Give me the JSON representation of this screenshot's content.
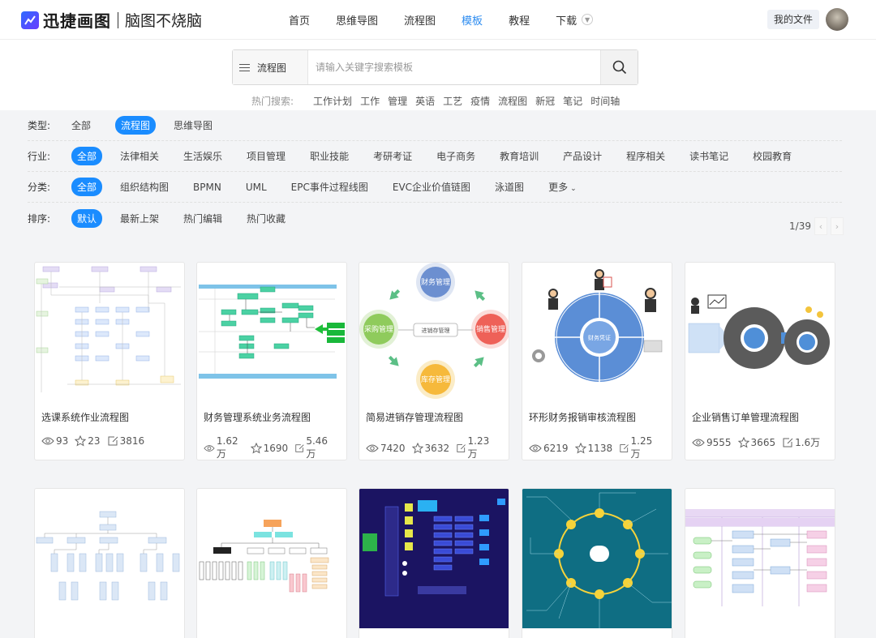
{
  "header": {
    "brand": "迅捷画图",
    "slogan": "脑图不烧脑",
    "nav": [
      {
        "label": "首页",
        "active": false
      },
      {
        "label": "思维导图",
        "active": false
      },
      {
        "label": "流程图",
        "active": false
      },
      {
        "label": "模板",
        "active": true
      },
      {
        "label": "教程",
        "active": false
      },
      {
        "label": "下载",
        "active": false
      }
    ],
    "my_files": "我的文件"
  },
  "search": {
    "type_label": "流程图",
    "placeholder": "请输入关键字搜索模板",
    "hot_label": "热门搜索:",
    "hot_terms": [
      "工作计划",
      "工作",
      "管理",
      "英语",
      "工艺",
      "疫情",
      "流程图",
      "新冠",
      "笔记",
      "时间轴"
    ]
  },
  "filters": {
    "type": {
      "label": "类型:",
      "items": [
        "全部",
        "流程图",
        "思维导图"
      ],
      "selected": 1
    },
    "industry": {
      "label": "行业:",
      "items": [
        "全部",
        "法律相关",
        "生活娱乐",
        "项目管理",
        "职业技能",
        "考研考证",
        "电子商务",
        "教育培训",
        "产品设计",
        "程序相关",
        "读书笔记",
        "校园教育"
      ],
      "selected": 0
    },
    "category": {
      "label": "分类:",
      "items": [
        "全部",
        "组织结构图",
        "BPMN",
        "UML",
        "EPC事件过程线图",
        "EVC企业价值链图",
        "泳道图",
        "更多"
      ],
      "selected": 0
    },
    "sort": {
      "label": "排序:",
      "items": [
        "默认",
        "最新上架",
        "热门编辑",
        "热门收藏"
      ],
      "selected": 0
    }
  },
  "pager": {
    "text": "1/39"
  },
  "cards": [
    {
      "title": "选课系统作业流程图",
      "views": "93",
      "stars": "23",
      "edits": "3816"
    },
    {
      "title": "财务管理系统业务流程图",
      "views": "1.62万",
      "stars": "1690",
      "edits": "5.46万"
    },
    {
      "title": "简易进销存管理流程图",
      "views": "7420",
      "stars": "3632",
      "edits": "1.23万"
    },
    {
      "title": "环形财务报销审核流程图",
      "views": "6219",
      "stars": "1138",
      "edits": "1.25万"
    },
    {
      "title": "企业销售订单管理流程图",
      "views": "9555",
      "stars": "3665",
      "edits": "1.6万"
    },
    {
      "title": "",
      "views": "",
      "stars": "",
      "edits": ""
    },
    {
      "title": "",
      "views": "",
      "stars": "",
      "edits": ""
    },
    {
      "title": "",
      "views": "",
      "stars": "",
      "edits": ""
    },
    {
      "title": "",
      "views": "",
      "stars": "",
      "edits": ""
    },
    {
      "title": "",
      "views": "",
      "stars": "",
      "edits": ""
    }
  ],
  "thumb_texts": {
    "jxc": {
      "finance": "财务管理",
      "sales": "销售管理",
      "purchase": "采购管理",
      "stock": "库存管理",
      "center": "进销存管理"
    },
    "ring": {
      "center": "财务凭证"
    }
  },
  "colors": {
    "accent": "#1a8cff",
    "nav_active": "#2d8cf0"
  }
}
